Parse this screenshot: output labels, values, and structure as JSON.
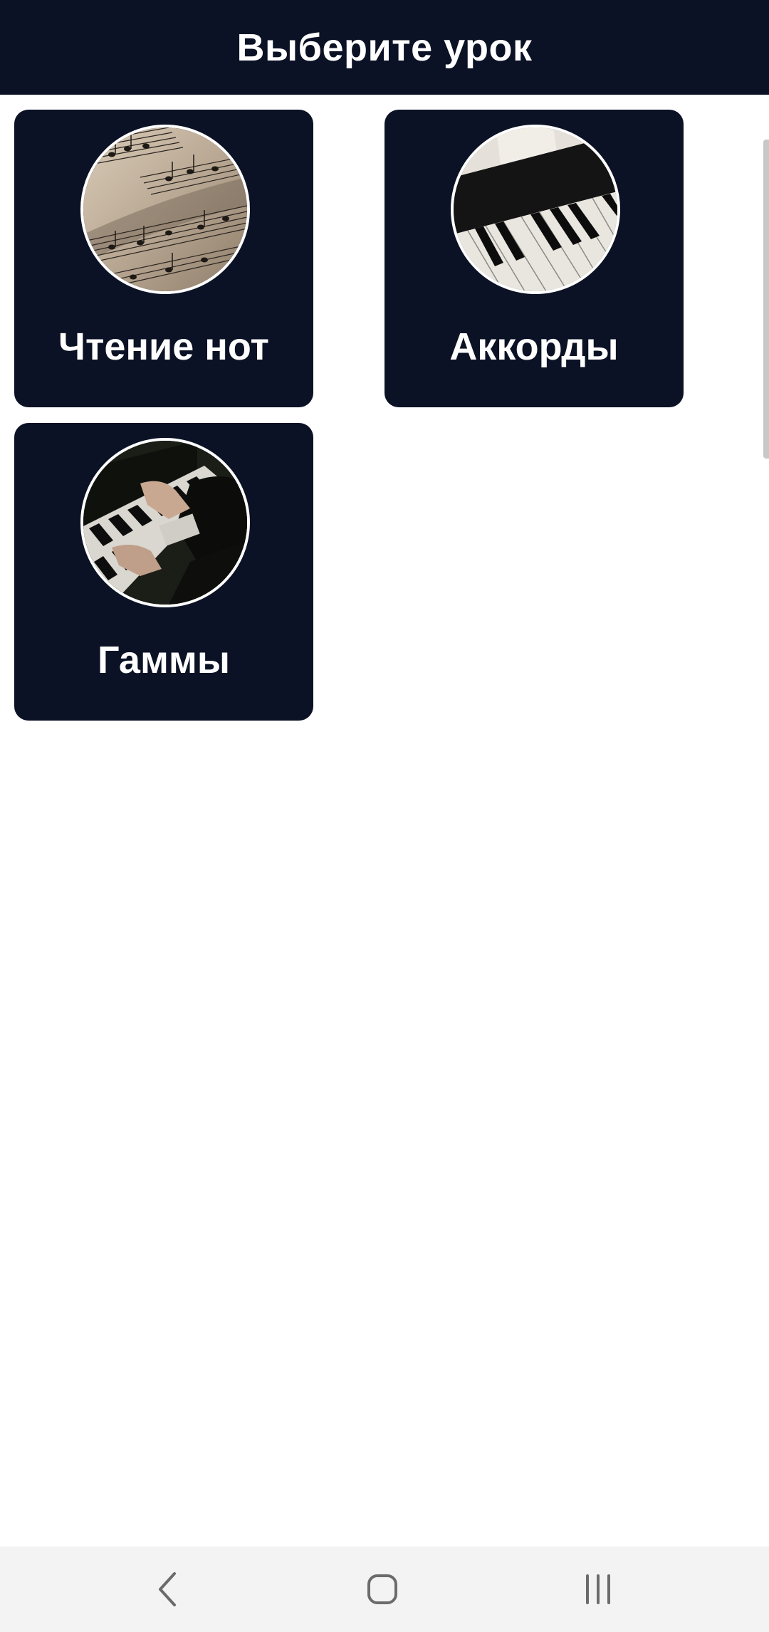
{
  "header": {
    "title": "Выберите урок"
  },
  "lessons": [
    {
      "label": "Чтение нот",
      "image": "sheet-music-photo"
    },
    {
      "label": "Аккорды",
      "image": "piano-keys-photo"
    },
    {
      "label": "Гаммы",
      "image": "hands-on-piano-photo"
    }
  ],
  "navigation": {
    "back_icon": "back-chevron-icon",
    "home_icon": "home-rounded-square-icon",
    "recents_icon": "recents-bars-icon"
  },
  "colors": {
    "primary_dark": "#0b1225",
    "card_text": "#ffffff",
    "background": "#ffffff",
    "nav_background": "#f3f3f3"
  }
}
